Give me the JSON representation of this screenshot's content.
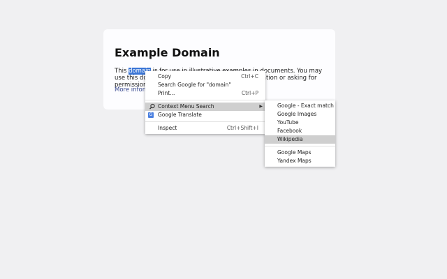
{
  "page": {
    "title": "Example Domain",
    "para_before": "This ",
    "para_selected": "domain",
    "para_after": " is for use in illustrative examples in documents. You may use this domain in literature without prior coordination or asking for permission.",
    "more_link": "More information..."
  },
  "context_menu": {
    "items": [
      {
        "label": "Copy",
        "shortcut": "Ctrl+C"
      },
      {
        "label": "Search Google for \"domain\"",
        "shortcut": ""
      },
      {
        "label": "Print...",
        "shortcut": "Ctrl+P"
      },
      {
        "label": "Context Menu Search",
        "shortcut": "",
        "icon": "search-icon"
      },
      {
        "label": "Google Translate",
        "shortcut": "",
        "icon": "translate-icon"
      },
      {
        "label": "Inspect",
        "shortcut": "Ctrl+Shift+I"
      }
    ]
  },
  "submenu": {
    "items": [
      {
        "label": "Google - Exact match"
      },
      {
        "label": "Google Images"
      },
      {
        "label": "YouTube"
      },
      {
        "label": "Facebook"
      },
      {
        "label": "Wikipedia"
      },
      {
        "label": "Google Maps"
      },
      {
        "label": "Yandex Maps"
      }
    ]
  },
  "colors": {
    "background": "#f0f0f2",
    "selection": "#3b76d6",
    "link": "#38488f",
    "highlight": "#cfcfcf"
  }
}
